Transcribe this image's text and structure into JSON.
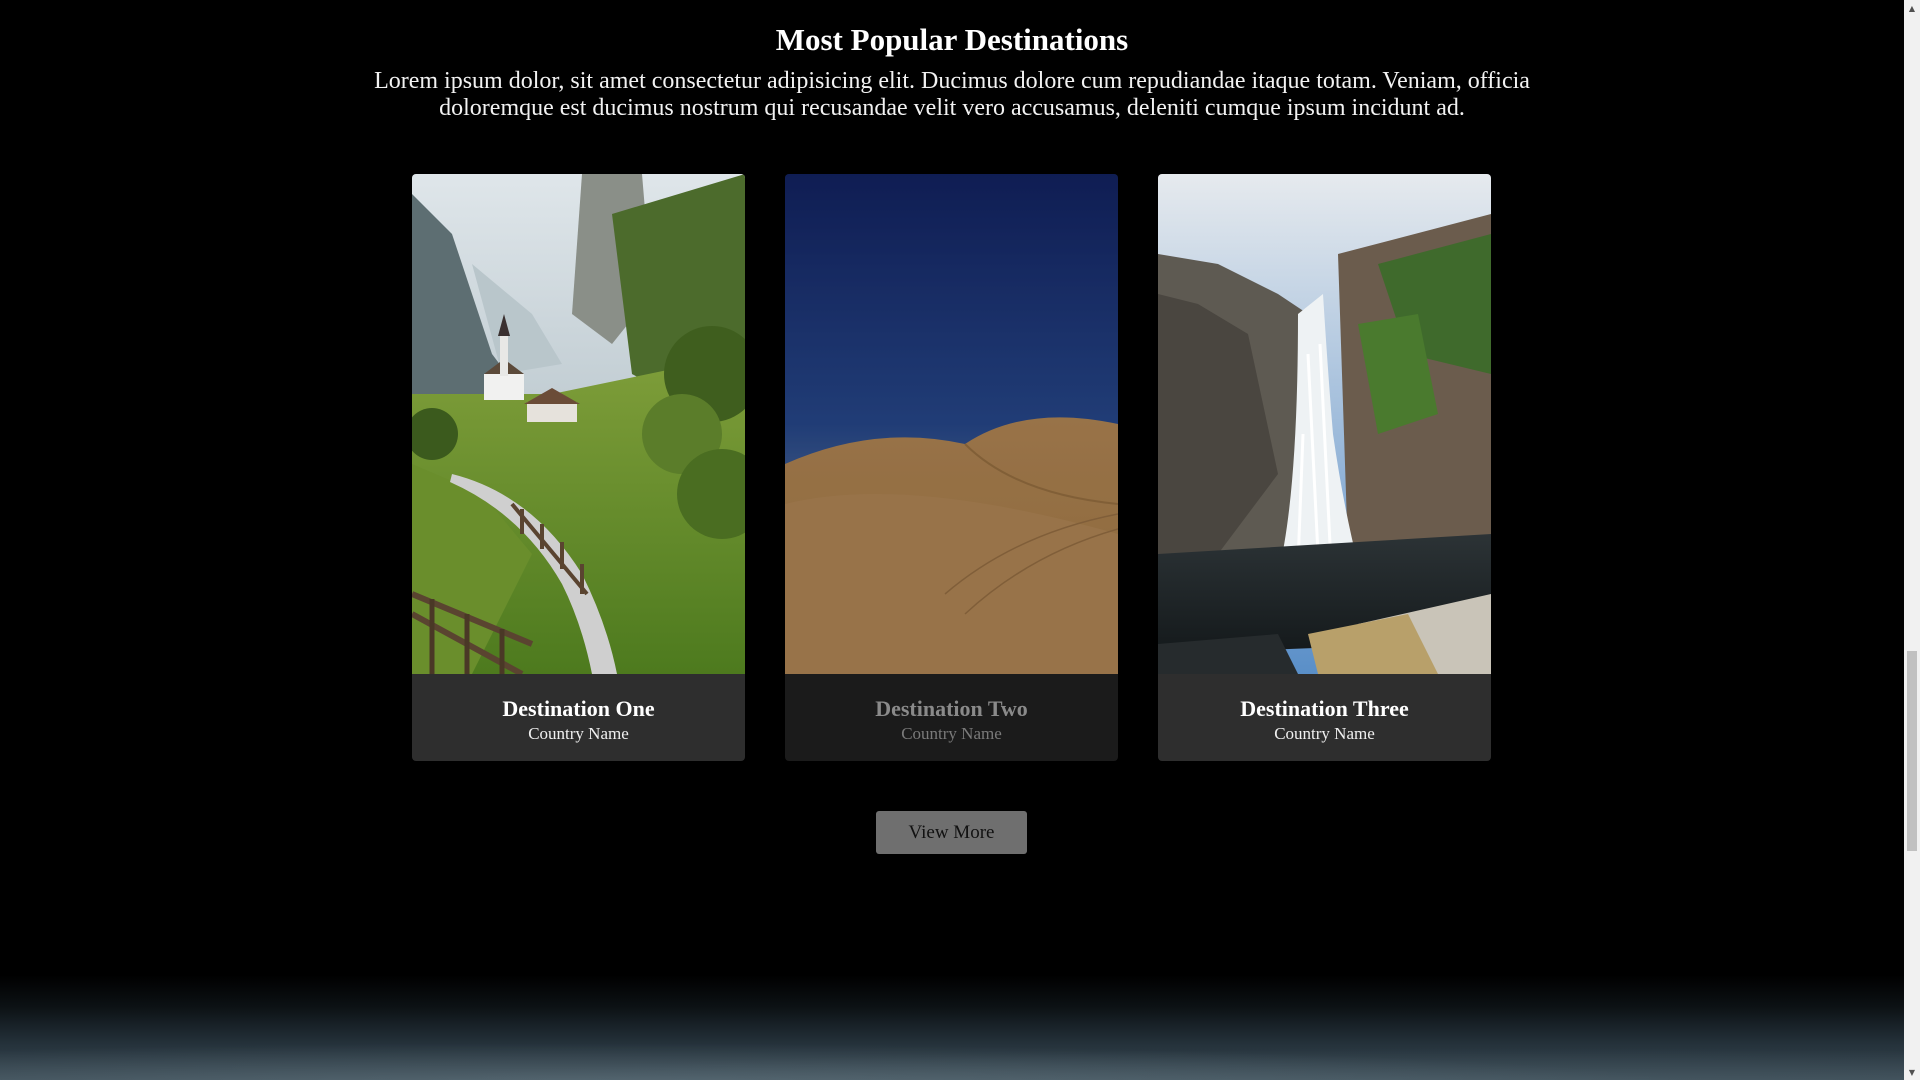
{
  "section": {
    "title": "Most Popular Destinations",
    "description": "Lorem ipsum dolor, sit amet consectetur adipisicing elit. Ducimus dolore cum repudiandae itaque totam. Veniam, officia doloremque est ducimus nostrum qui recusandae velit vero accusamus, deleniti cumque ipsum incidunt ad."
  },
  "cards": [
    {
      "title": "Destination One",
      "subtitle": "Country Name",
      "image": "alpine-valley-village-path"
    },
    {
      "title": "Destination Two",
      "subtitle": "Country Name",
      "image": "desert-sand-dunes"
    },
    {
      "title": "Destination Three",
      "subtitle": "Country Name",
      "image": "waterfall-rocky-cliff"
    }
  ],
  "button": {
    "view_more": "View More"
  },
  "colors": {
    "background": "#000000",
    "card": "#2e2e2e",
    "button": "#6f6f6f"
  }
}
